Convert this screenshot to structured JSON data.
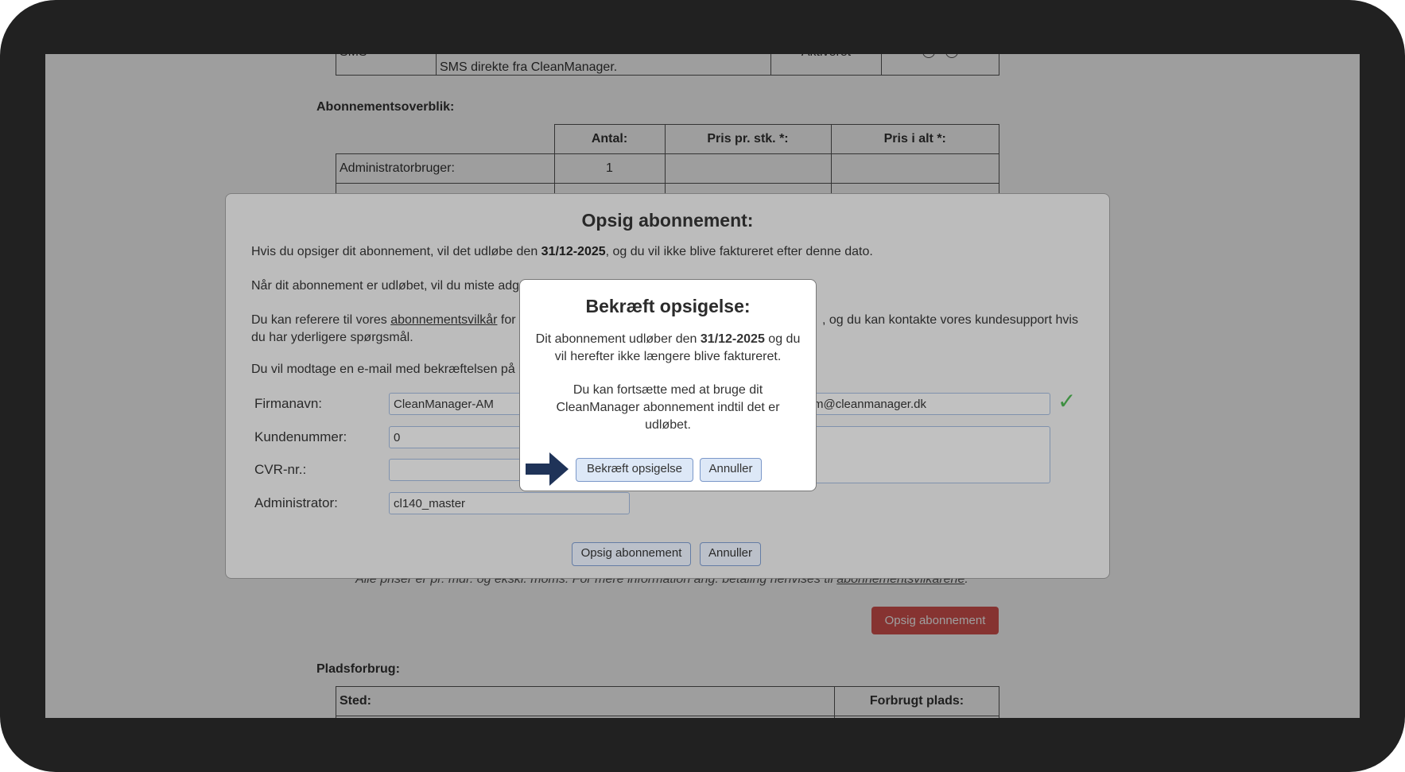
{
  "background": {
    "sms_row": {
      "label": "SMS",
      "description": "SMS direkte fra CleanManager.",
      "status": "Aktiveret"
    },
    "overview_title": "Abonnementsoverblik:",
    "overview_headers": [
      "Antal:",
      "Pris pr. stk. *:",
      "Pris i alt *:"
    ],
    "overview_rows": [
      {
        "label": "Administratorbruger:",
        "antal": "1"
      }
    ],
    "price_note_prefix": "* Alle priser er pr. mdr. og ekskl. moms. For mere information ang. betaling henvises til ",
    "price_note_link": "abonnementsvilkårene",
    "price_note_suffix": ".",
    "cancel_subscription_button": "Opsig abonnement",
    "space_title": "Pladsforbrug:",
    "space_headers": [
      "Sted:",
      "Forbrugt plads:"
    ]
  },
  "modal": {
    "title": "Opsig abonnement:",
    "para1_prefix": "Hvis du opsiger dit abonnement, vil det udløbe den ",
    "para1_date": "31/12-2025",
    "para1_suffix": ", og du vil ikke blive faktureret efter denne dato.",
    "para2": "Når dit abonnement er udløbet, vil du miste adg",
    "para3_prefix": "Du kan referere til vores ",
    "para3_link": "abonnementsvilkår",
    "para3_mid": " for",
    "para3_right": ", og du kan kontakte vores kundesupport hvis",
    "para3_line2": "du har yderligere spørgsmål.",
    "para4": "Du vil modtage en e-mail med bekræftelsen på",
    "fields": {
      "company_label": "Firmanavn:",
      "company_value": "CleanManager-AM",
      "customer_label": "Kundenummer:",
      "customer_value": "0",
      "cvr_label": "CVR-nr.:",
      "cvr_value": "",
      "admin_label": "Administrator:",
      "admin_value": "cl140_master",
      "email_value": "m@cleanmanager.dk",
      "comment_value": ""
    },
    "confirm_button": "Opsig abonnement",
    "cancel_button": "Annuller"
  },
  "confirm_dialog": {
    "title": "Bekræft opsigelse:",
    "line1_prefix": "Dit abonnement udløber den ",
    "line1_date": "31/12-2025",
    "line1_suffix": " og du",
    "line2": "vil herefter ikke længere blive faktureret.",
    "line3": "Du kan fortsætte med at bruge dit",
    "line4": "CleanManager abonnement indtil det er",
    "line5": "udløbet.",
    "confirm_button": "Bekræft opsigelse",
    "cancel_button": "Annuller"
  },
  "colors": {
    "danger": "#d9534f",
    "check": "#4caf50",
    "arrow": "#1f3358",
    "bezel": "#212121"
  }
}
